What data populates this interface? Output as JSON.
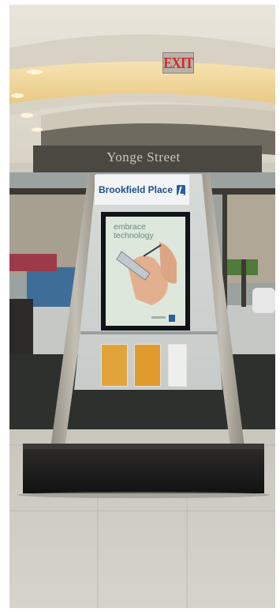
{
  "scene": {
    "exit_sign": "EXIT",
    "street_name": "Yonge Street",
    "kiosk": {
      "brand": "Brookfield Place",
      "poster_headline": "embrace technology"
    }
  },
  "icons": {
    "brand_logo": "brookfield-logo-icon",
    "pen_hand": "hand-with-stylus-icon"
  },
  "colors": {
    "brand_blue": "#1d4f8c",
    "exit_red": "#d8262b",
    "brochure_orange": "#e5a128",
    "base_black": "#1c1b1b"
  }
}
